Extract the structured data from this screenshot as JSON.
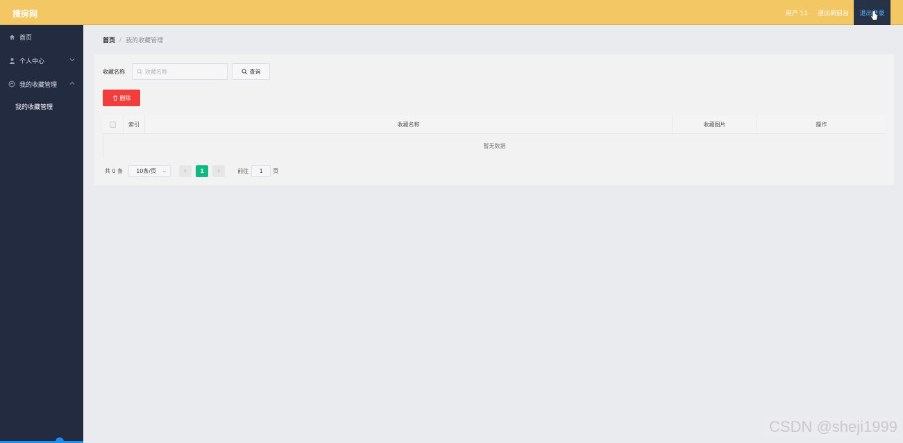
{
  "header": {
    "brand": "搜房网",
    "user": "用户 11",
    "back_to_admin": "退出到前台",
    "logout": "退出登录"
  },
  "sidebar": {
    "items": [
      {
        "label": "首页",
        "icon": "home-icon"
      },
      {
        "label": "个人中心",
        "icon": "user-icon",
        "expanded": false
      },
      {
        "label": "我的收藏管理",
        "icon": "collection-icon",
        "expanded": true
      }
    ],
    "submenu": [
      {
        "label": "我的收藏管理"
      }
    ]
  },
  "breadcrumb": {
    "home": "首页",
    "separator": "/",
    "current": "我的收藏管理"
  },
  "search": {
    "label": "收藏名称",
    "placeholder": "收藏名称",
    "button": "查询"
  },
  "actions": {
    "delete": "删除"
  },
  "table": {
    "columns": [
      "索引",
      "收藏名称",
      "收藏图片",
      "操作"
    ],
    "empty_text": "暂无数据"
  },
  "pagination": {
    "total": "共 0 条",
    "page_size": "10条/页",
    "current_page": "1",
    "goto_label": "前往",
    "goto_value": "1",
    "goto_suffix": "页"
  },
  "colors": {
    "header_bg": "#f3c764",
    "sidebar_bg": "#232b41",
    "danger": "#f23d3d",
    "pager_active": "#10b981"
  },
  "watermark": "CSDN @sheji1999"
}
